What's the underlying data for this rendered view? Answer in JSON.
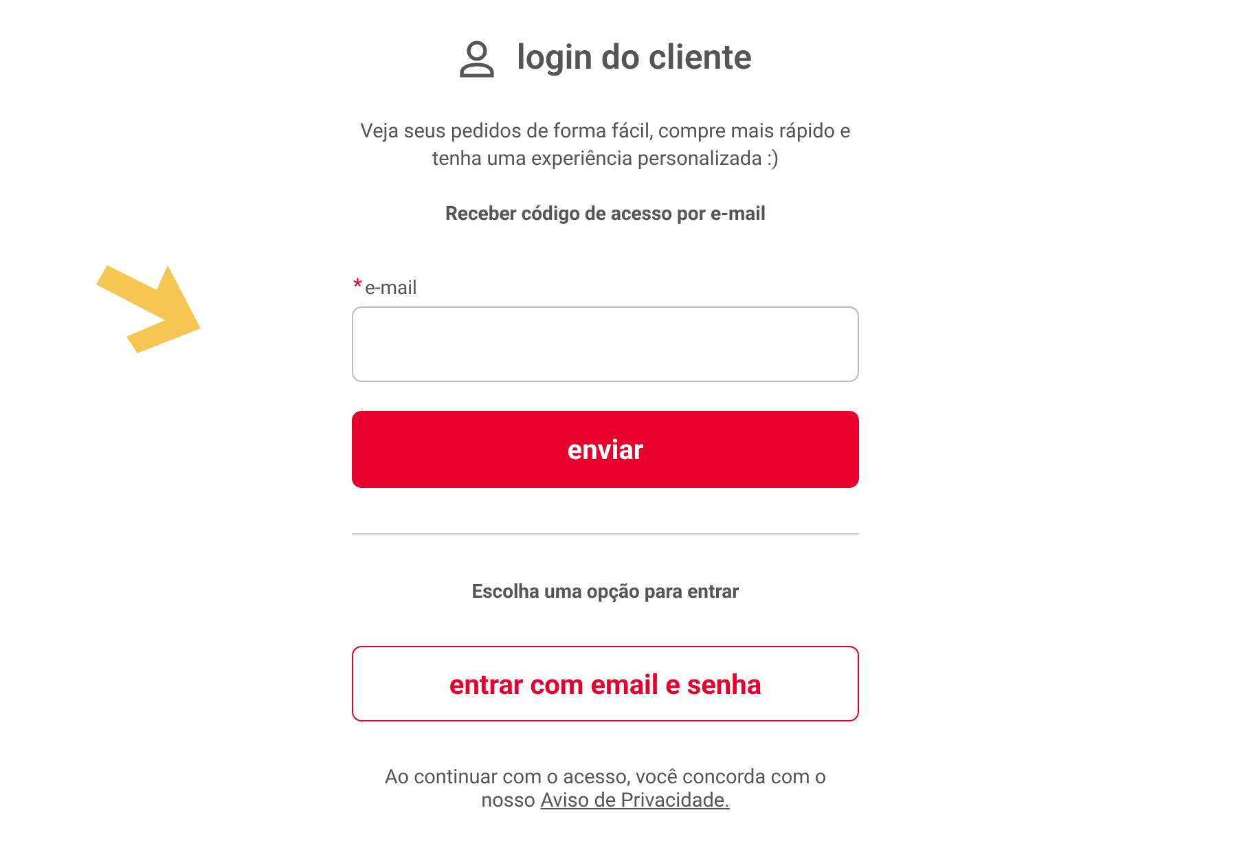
{
  "header": {
    "title": "login do cliente"
  },
  "intro": "Veja seus pedidos de forma fácil, compre mais rápido e tenha uma experiência personalizada :)",
  "code_heading": "Receber código de acesso por e-mail",
  "email_field": {
    "label": "e-mail",
    "required": true,
    "required_mark": "*"
  },
  "submit_button": "enviar",
  "options_heading": "Escolha uma opção para entrar",
  "password_button": "entrar com email e senha",
  "notice": {
    "text": "Ao continuar com o acesso, você concorda com o nosso ",
    "link": "Aviso de Privacidade."
  }
}
